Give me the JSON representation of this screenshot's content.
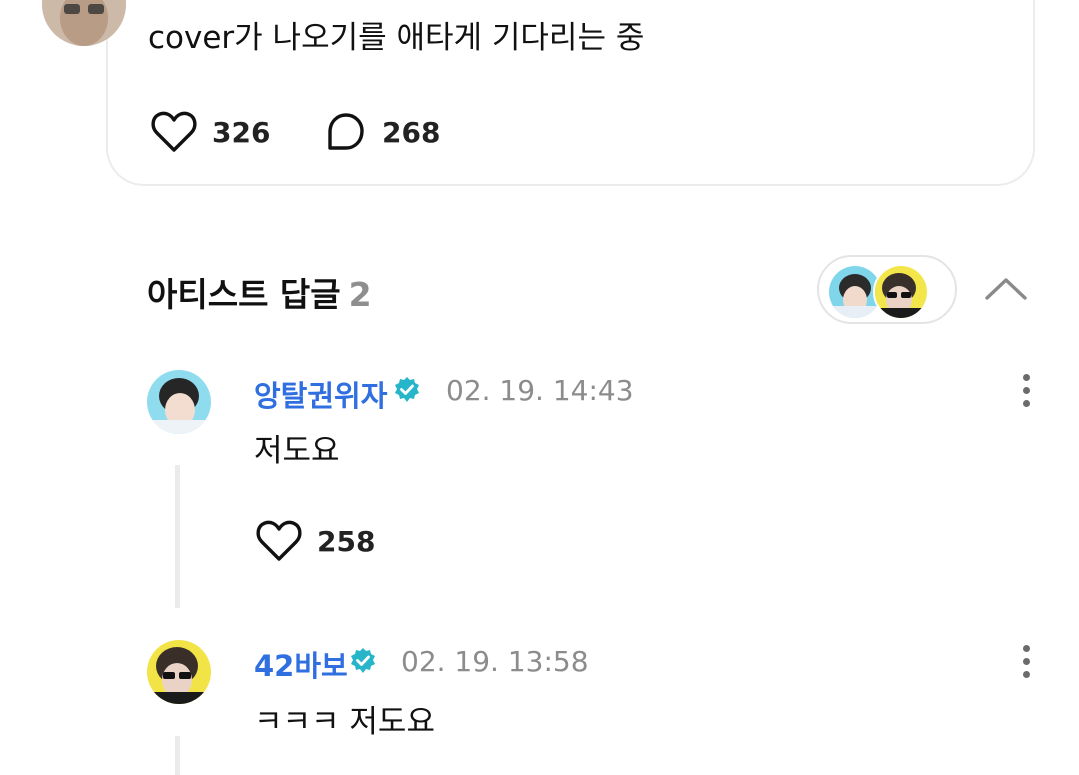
{
  "post": {
    "text": "cover가 나오기를 애타게 기다리는 중",
    "like_count": "326",
    "comment_count": "268"
  },
  "artist_replies": {
    "title": "아티스트 답글",
    "count": "2"
  },
  "replies": [
    {
      "name": "앙탈권위자",
      "timestamp": "02. 19. 14:43",
      "text": "저도요",
      "like_count": "258"
    },
    {
      "name": "42바보",
      "timestamp": "02. 19. 13:58",
      "text": "ㅋㅋㅋ 저도요"
    }
  ],
  "colors": {
    "name_blue": "#2f6fe0",
    "verified_teal": "#27b5c9",
    "muted_gray": "#8c8c8c"
  },
  "icons": [
    "heart-icon",
    "comment-bubble-icon",
    "chevron-up-icon",
    "verified-badge-icon",
    "more-vertical-icon"
  ]
}
